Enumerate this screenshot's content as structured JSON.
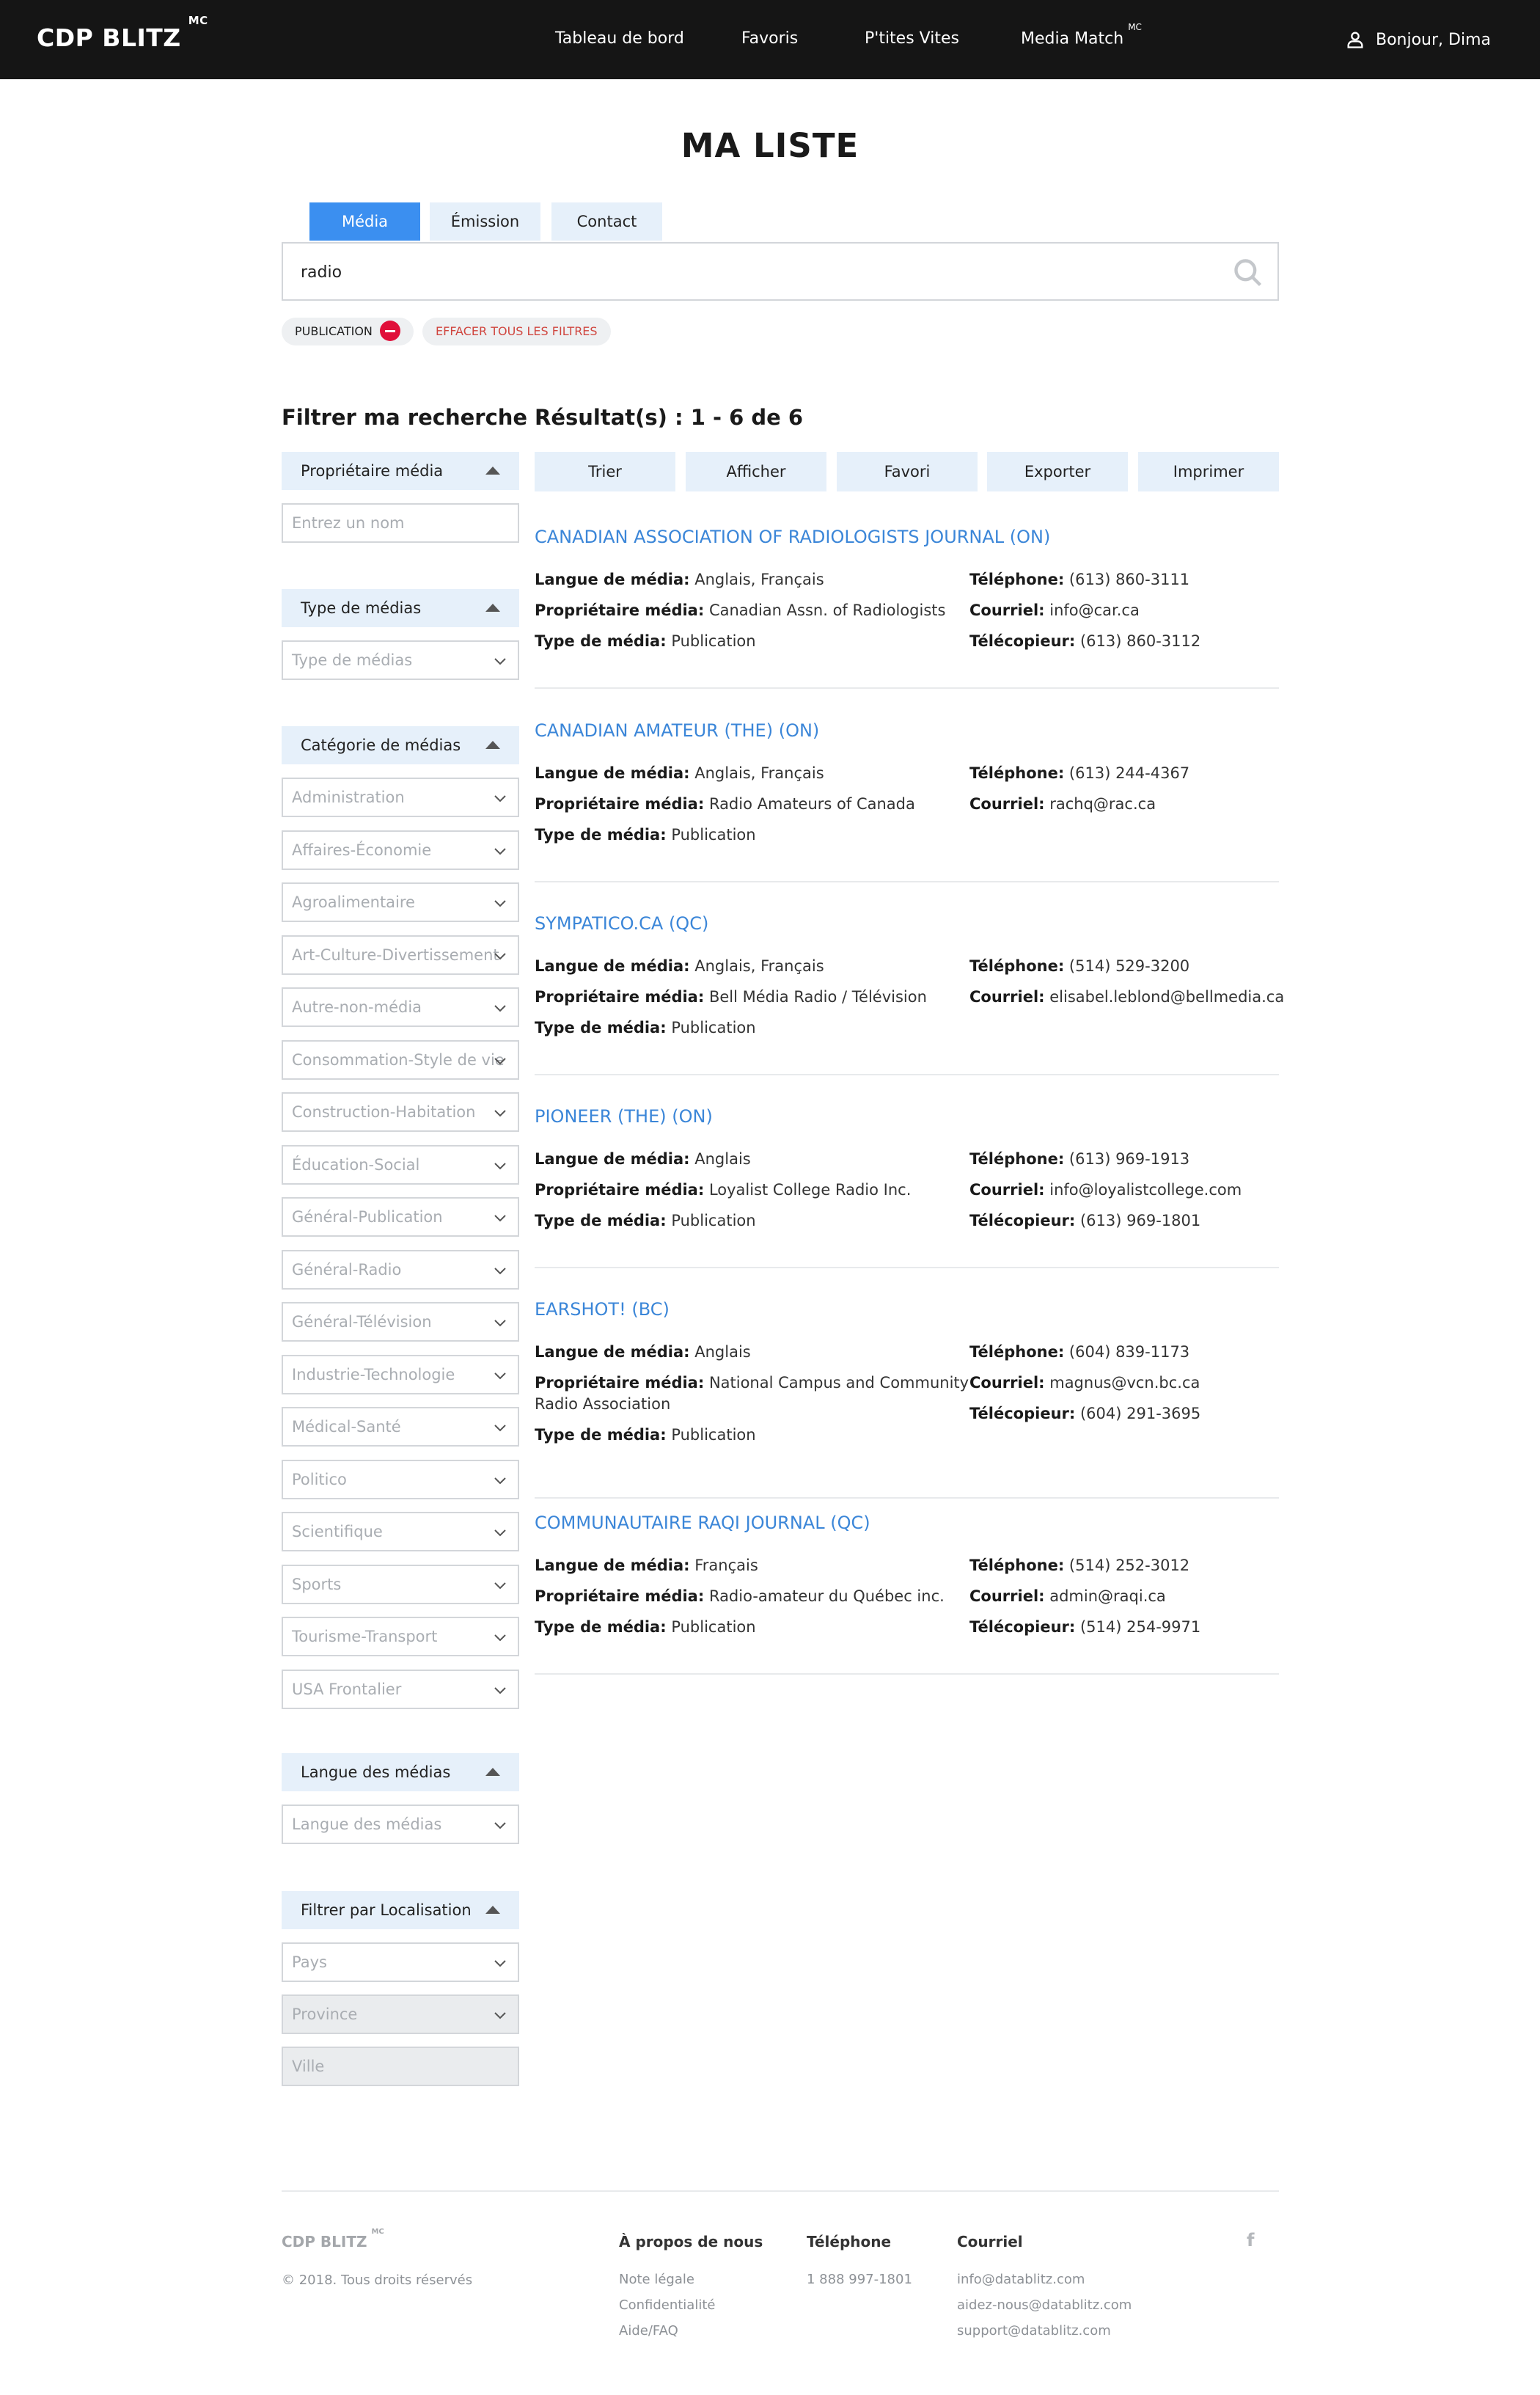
{
  "header": {
    "logo": "CDP BLITZ",
    "logo_sup": "MC",
    "nav": [
      "Tableau de bord",
      "Favoris",
      "P'tites Vites",
      "Media Match"
    ],
    "nav_sup": "MC",
    "greeting": "Bonjour, Dima"
  },
  "page": {
    "title": "MA LISTE"
  },
  "tabs": [
    "Média",
    "Émission",
    "Contact"
  ],
  "search": {
    "value": "radio"
  },
  "chips": {
    "publication": "PUBLICATION",
    "clear": "EFFACER TOUS LES FILTRES"
  },
  "sidebar": {
    "title": "Filtrer ma recherche",
    "owner_header": "Propriétaire média",
    "owner_placeholder": "Entrez un nom",
    "type_header": "Type de médias",
    "type_select": "Type de médias",
    "category_header": "Catégorie de médias",
    "categories": [
      "Administration",
      "Affaires-Économie",
      "Agroalimentaire",
      "Art-Culture-Divertissement",
      "Autre-non-média",
      "Consommation-Style de vie",
      "Construction-Habitation",
      "Éducation-Social",
      "Général-Publication",
      "Général-Radio",
      "Général-Télévision",
      "Industrie-Technologie",
      "Médical-Santé",
      "Politico",
      "Scientifique",
      "Sports",
      "Tourisme-Transport",
      "USA Frontalier"
    ],
    "lang_header": "Langue des médias",
    "lang_select": "Langue des médias",
    "loc_header": "Filtrer par Localisation",
    "country": "Pays",
    "province": "Province",
    "city": "Ville"
  },
  "results": {
    "title": "Résultat(s) : 1 - 6 de 6",
    "actions": [
      "Trier",
      "Afficher",
      "Favori",
      "Exporter",
      "Imprimer"
    ],
    "labels": {
      "lang": "Langue de média:",
      "owner": "Propriétaire média:",
      "type": "Type de média:",
      "phone": "Téléphone:",
      "email": "Courriel:",
      "fax": "Télécopieur:"
    },
    "items": [
      {
        "title": "CANADIAN ASSOCIATION OF RADIOLOGISTS JOURNAL (ON)",
        "lang": "Anglais, Français",
        "owner": "Canadian Assn. of Radiologists",
        "type": "Publication",
        "phone": "(613) 860-3111",
        "email": "info@car.ca",
        "fax": "(613) 860-3112"
      },
      {
        "title": "CANADIAN AMATEUR (THE) (ON)",
        "lang": "Anglais, Français",
        "owner": "Radio Amateurs of Canada",
        "type": "Publication",
        "phone": "(613) 244-4367",
        "email": "rachq@rac.ca"
      },
      {
        "title": "SYMPATICO.CA (QC)",
        "lang": "Anglais, Français",
        "owner": "Bell Média Radio / Télévision",
        "type": "Publication",
        "phone": "(514) 529-3200",
        "email": "elisabel.leblond@bellmedia.ca"
      },
      {
        "title": "PIONEER (THE) (ON)",
        "lang": "Anglais",
        "owner": "Loyalist College Radio Inc.",
        "type": "Publication",
        "phone": "(613) 969-1913",
        "email": "info@loyalistcollege.com",
        "fax": "(613) 969-1801"
      },
      {
        "title": "EARSHOT! (BC)",
        "lang": "Anglais",
        "owner": "National Campus and Community",
        "owner2": "Radio Association",
        "type": "Publication",
        "phone": "(604) 839-1173",
        "email": "magnus@vcn.bc.ca",
        "fax": "(604) 291-3695"
      },
      {
        "title": "COMMUNAUTAIRE RAQI JOURNAL (QC)",
        "lang": "Français",
        "owner": "Radio-amateur du Québec inc.",
        "type": "Publication",
        "phone": "(514) 252-3012",
        "email": "admin@raqi.ca",
        "fax": "(514) 254-9971"
      }
    ]
  },
  "footer": {
    "logo": "CDP BLITZ",
    "logo_sup": "MC",
    "copyright": "© 2018. Tous droits réservés",
    "about_header": "À propos de nous",
    "about_links": [
      "Note légale",
      "Confidentialité",
      "Aide/FAQ"
    ],
    "phone_header": "Téléphone",
    "phone": "1 888 997-1801",
    "email_header": "Courriel",
    "emails": [
      "info@datablitz.com",
      "aidez-nous@datablitz.com",
      "support@datablitz.com"
    ],
    "facebook": "f"
  },
  "colors": {
    "accent": "#3b8ff0",
    "link": "#3b86d8",
    "header_bg": "#151515",
    "danger": "#e0103a"
  }
}
